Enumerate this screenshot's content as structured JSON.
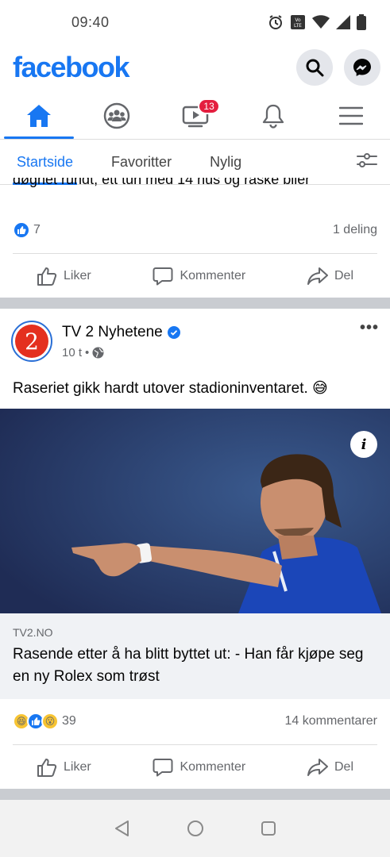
{
  "status_bar": {
    "time": "09:40",
    "icons": [
      "alarm-icon",
      "volte-icon",
      "wifi-icon",
      "signal-icon",
      "battery-icon"
    ],
    "volte_label": "VoLTE"
  },
  "header": {
    "logo": "facebook",
    "search_icon": "search-icon",
    "messenger_icon": "messenger-icon"
  },
  "nav": {
    "tabs": [
      "home",
      "groups",
      "watch",
      "notifications",
      "menu"
    ],
    "watch_badge": "13"
  },
  "feed_tabs": {
    "items": [
      "Startside",
      "Favoritter",
      "Nylig"
    ],
    "active": "Startside"
  },
  "previous_post": {
    "text_fragment": "døgnet rundt, ett tun med 14 hus og raske biler",
    "reaction_count": "7",
    "shares": "1 deling"
  },
  "actions": {
    "like": "Liker",
    "comment": "Kommenter",
    "share": "Del"
  },
  "post": {
    "author": "TV 2 Nyhetene",
    "avatar_glyph": "2",
    "time": "10 t",
    "text": "Raseriet gikk hardt utover stadioninventaret. 😅",
    "link_domain": "TV2.NO",
    "link_title": "Rasende etter å ha blitt byttet ut: - Han får kjøpe seg en ny Rolex som trøst",
    "info_glyph": "i",
    "reaction_count": "39",
    "comments": "14 kommentarer"
  },
  "colors": {
    "brand": "#1877f2",
    "badge": "#e41e3f",
    "avatar_red": "#e4301f"
  }
}
